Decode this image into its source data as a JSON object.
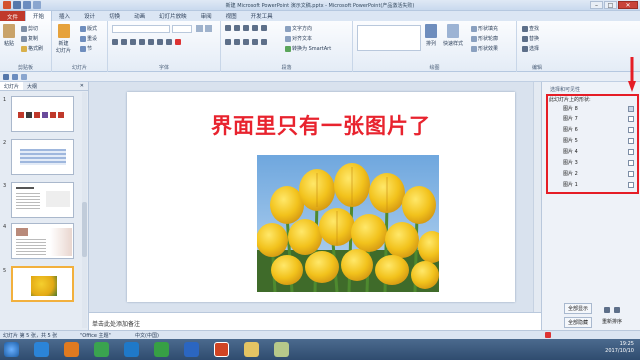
{
  "titlebar": {
    "title": "新建 Microsoft PowerPoint 演示文稿.pptx - Microsoft PowerPoint(产品激活失败)"
  },
  "tabs": [
    "文件",
    "开始",
    "插入",
    "设计",
    "切换",
    "动画",
    "幻灯片放映",
    "审阅",
    "视图",
    "开发工具"
  ],
  "ribbon": {
    "clipboard": {
      "paste": "粘贴",
      "cut": "剪切",
      "copy": "复制",
      "format_painter": "格式刷",
      "label": "剪贴板"
    },
    "slides": {
      "new_slide": "新建\n幻灯片",
      "layout": "版式",
      "reset": "重设",
      "section": "节",
      "label": "幻灯片"
    },
    "font": {
      "label": "字体"
    },
    "paragraph": {
      "text_direction": "文字方向",
      "align_text": "对齐文本",
      "smartart": "转换为 SmartArt",
      "label": "段落"
    },
    "drawing": {
      "arrange": "排列",
      "quick_styles": "快速样式",
      "shape_fill": "形状填充",
      "shape_outline": "形状轮廓",
      "shape_effects": "形状效果",
      "label": "绘图"
    },
    "editing": {
      "find": "查找",
      "replace": "替换",
      "select": "选择",
      "label": "编辑"
    }
  },
  "leftpanel": {
    "tabs": [
      "幻灯片",
      "大纲"
    ],
    "slides": [
      {
        "number": "1",
        "kind": "icons"
      },
      {
        "number": "2",
        "kind": "table"
      },
      {
        "number": "3",
        "kind": "text"
      },
      {
        "number": "4",
        "kind": "photo-text"
      },
      {
        "number": "5",
        "kind": "tulip"
      }
    ],
    "selected_slide": "5"
  },
  "slide": {
    "title": "界面里只有一张图片了"
  },
  "notes": {
    "placeholder": "单击此处添加备注"
  },
  "selection_pane": {
    "title": "选择和可见性",
    "shapes_on_slide": "此幻灯片上的形状:",
    "items": [
      "图片 8",
      "图片 7",
      "图片 6",
      "图片 5",
      "图片 4",
      "图片 3",
      "图片 2",
      "图片 1"
    ],
    "show_all": "全部显示",
    "hide_all": "全部隐藏",
    "reorder": "重新排序",
    "highlight_color": "#e51d26"
  },
  "statusbar": {
    "slide_info": "幻灯片 第 5 张，共 5 张",
    "theme": "\"Office 主题\"",
    "language": "中文(中国)"
  },
  "taskbar": {
    "time": "19:25",
    "date": "2017/10/10"
  },
  "colors": {
    "accent_file_tab": "#c0392b",
    "title_red": "#e8232e",
    "selection_outline": "#e51d26"
  }
}
